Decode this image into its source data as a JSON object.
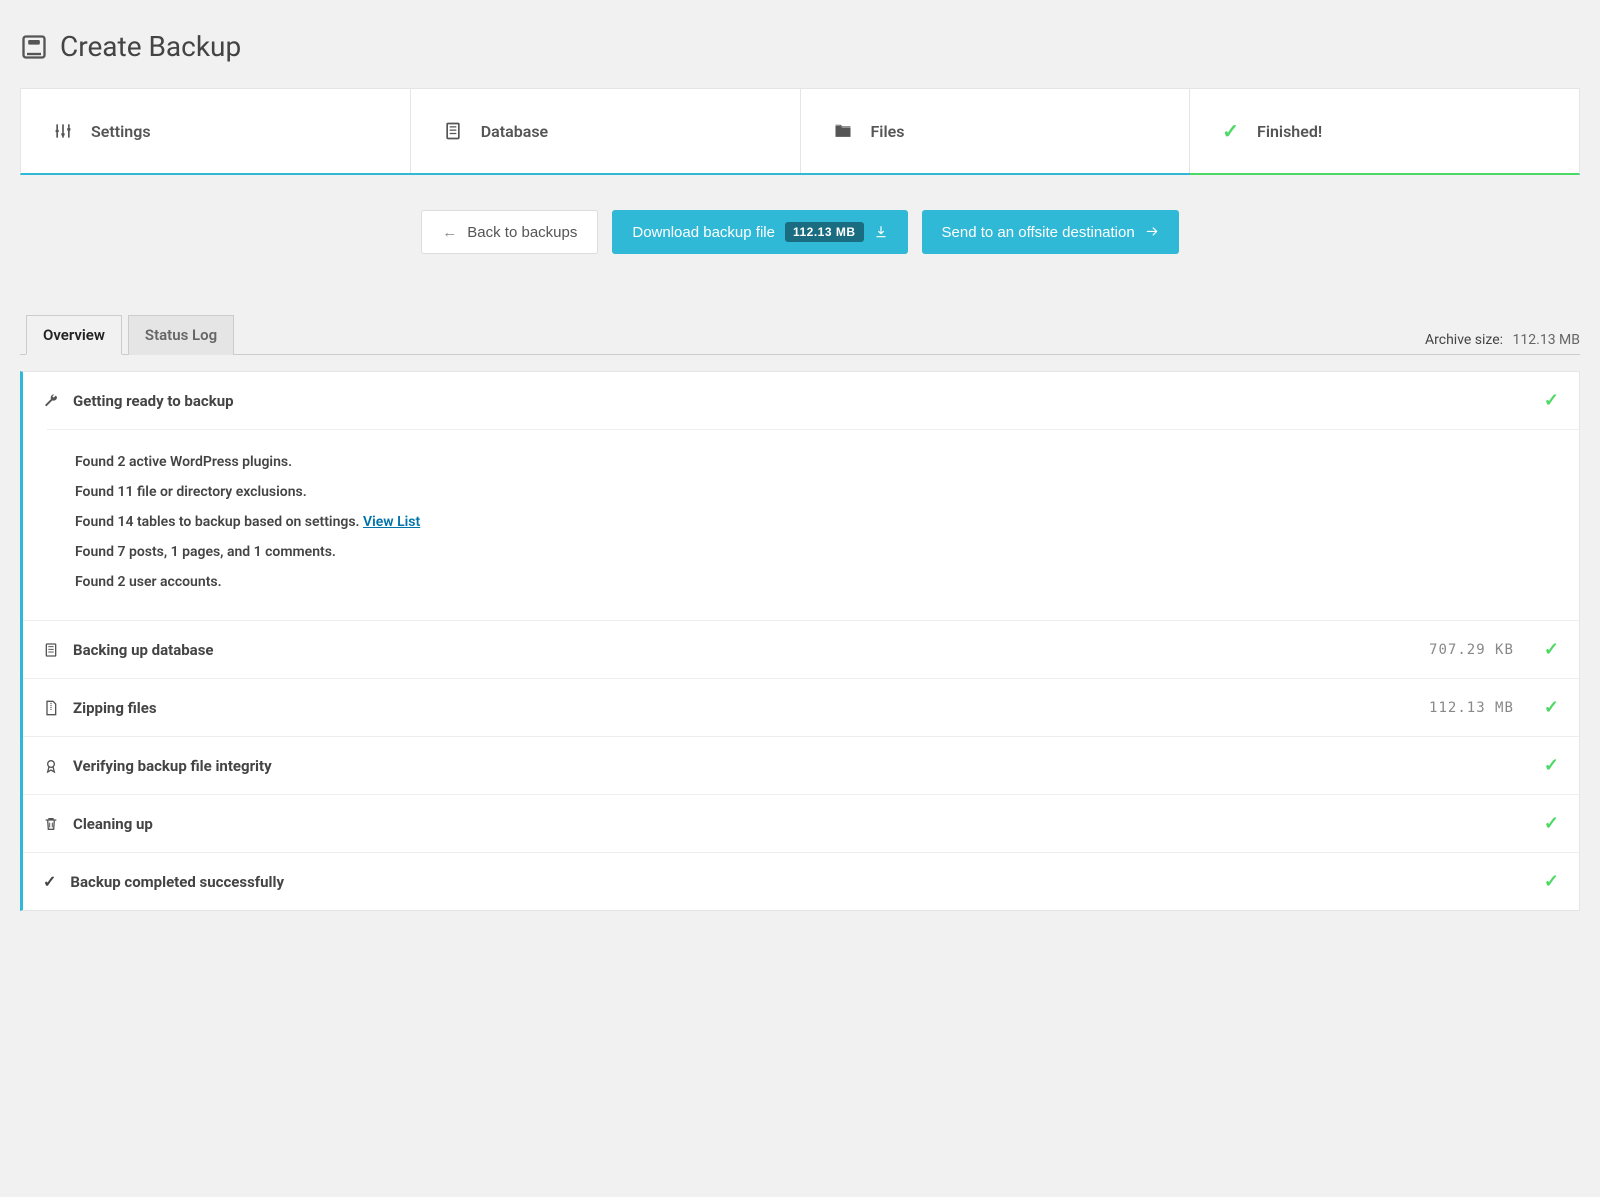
{
  "page": {
    "title": "Create Backup"
  },
  "steps": [
    {
      "label": "Settings"
    },
    {
      "label": "Database"
    },
    {
      "label": "Files"
    },
    {
      "label": "Finished!"
    }
  ],
  "actions": {
    "back": "Back to backups",
    "download": "Download backup file",
    "download_size": "112.13 MB",
    "offsite": "Send to an offsite destination"
  },
  "tabs": {
    "overview": "Overview",
    "status_log": "Status Log"
  },
  "archive": {
    "label": "Archive size:",
    "value": "112.13 MB"
  },
  "progress": {
    "ready": {
      "title": "Getting ready to backup",
      "details": {
        "plugins": "Found 2 active WordPress plugins.",
        "exclusions": "Found 11 file or directory exclusions.",
        "tables": "Found 14 tables to backup based on settings. ",
        "tables_link": "View List",
        "posts": "Found 7 posts, 1 pages, and 1 comments.",
        "users": "Found 2 user accounts."
      }
    },
    "db": {
      "title": "Backing up database",
      "size": "707.29 KB"
    },
    "zip": {
      "title": "Zipping files",
      "size": "112.13 MB"
    },
    "verify": {
      "title": "Verifying backup file integrity"
    },
    "clean": {
      "title": "Cleaning up"
    },
    "done": {
      "title": "Backup completed successfully"
    }
  }
}
